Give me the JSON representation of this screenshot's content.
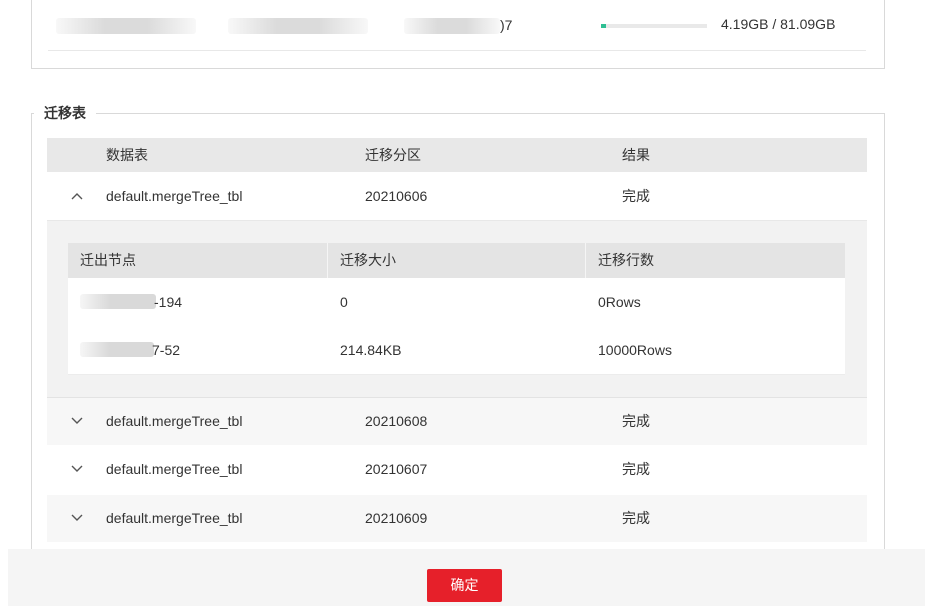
{
  "top_panel": {
    "row_suffix": ")7",
    "usage_fraction": 0.05,
    "usage_text": "4.19GB / 81.09GB",
    "usage_color": "#2fbf93"
  },
  "migration": {
    "legend": "迁移表",
    "headers": {
      "table": "数据表",
      "partition": "迁移分区",
      "result": "结果"
    },
    "expanded_row": {
      "icon": "chevron-up-icon",
      "table": "default.mergeTree_tbl",
      "partition": "20210606",
      "result": "完成"
    },
    "detail": {
      "headers": {
        "node": "迁出节点",
        "size": "迁移大小",
        "rows": "迁移行数"
      },
      "rows": [
        {
          "node": "-194",
          "size": "0",
          "rows": "0Rows"
        },
        {
          "node": "7-52",
          "size": "214.84KB",
          "rows": "10000Rows"
        }
      ]
    },
    "rows": [
      {
        "icon": "chevron-down-icon",
        "table": "default.mergeTree_tbl",
        "partition": "20210608",
        "result": "完成"
      },
      {
        "icon": "chevron-down-icon",
        "table": "default.mergeTree_tbl",
        "partition": "20210607",
        "result": "完成"
      },
      {
        "icon": "chevron-down-icon",
        "table": "default.mergeTree_tbl",
        "partition": "20210609",
        "result": "完成"
      }
    ]
  },
  "footer": {
    "confirm_label": "确定",
    "confirm_color": "#e6202a"
  }
}
